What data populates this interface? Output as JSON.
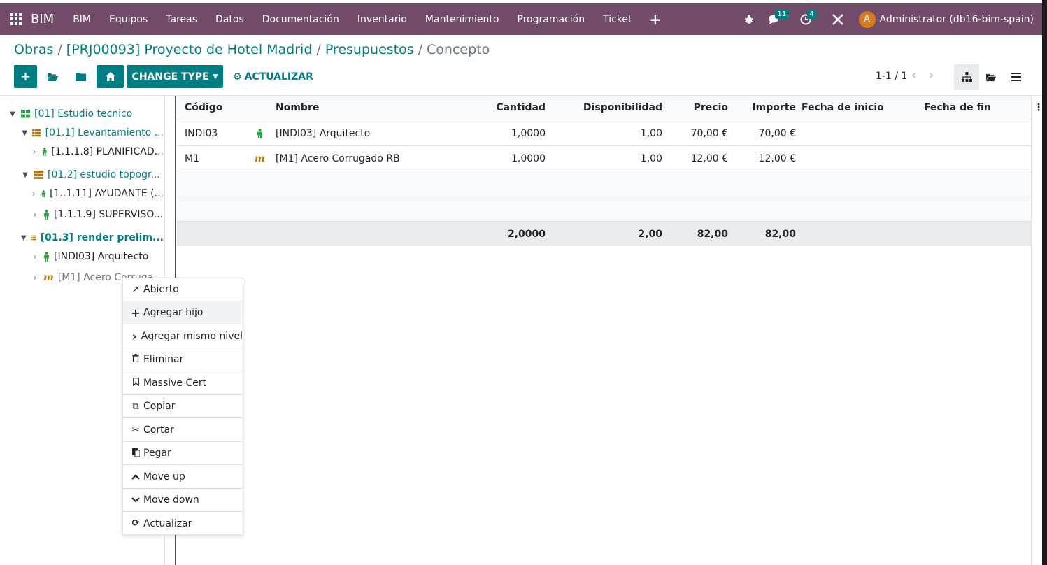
{
  "topbar": {
    "brand": "BIM",
    "menu": [
      "BIM",
      "Equipos",
      "Tareas",
      "Datos",
      "Documentación",
      "Inventario",
      "Mantenimiento",
      "Programación",
      "Ticket"
    ],
    "messages_count": "11",
    "activities_count": "4",
    "avatar_letter": "A",
    "user": "Administrator (db16-bim-spain)"
  },
  "breadcrumb": {
    "items": [
      "Obras",
      "[PRJ00093] Proyecto de Hotel Madrid",
      "Presupuestos"
    ],
    "current": "Concepto",
    "separator": "/"
  },
  "toolbar": {
    "change_type": "CHANGE TYPE",
    "update": "ACTUALIZAR",
    "pager": "1-1 / 1"
  },
  "tree": [
    {
      "label": "[01] Estudio tecnico",
      "icon": "grid-icon"
    },
    {
      "label": "[01.1] Levantamiento ...",
      "icon": "list-icon"
    },
    {
      "label": "[1.1.1.8] PLANIFICAD...",
      "icon": "person-icon"
    },
    {
      "label": "[01.2] estudio topogr...",
      "icon": "list-icon"
    },
    {
      "label": "[1..1.11] AYUDANTE (...",
      "icon": "person-icon"
    },
    {
      "label": "[1.1.1.9] SUPERVISO...",
      "icon": "person-icon"
    },
    {
      "label": "[01.3] render prelim...",
      "icon": "list-icon"
    },
    {
      "label": "[INDI03] Arquitecto",
      "icon": "person-icon"
    },
    {
      "label": "[M1] Acero Corruga...",
      "icon": "material-icon"
    }
  ],
  "table": {
    "columns": [
      "Código",
      "Nombre",
      "Cantidad",
      "Disponibilidad",
      "Precio",
      "Importe",
      "Fecha de inicio",
      "Fecha de fin"
    ],
    "rows": [
      {
        "codigo": "INDI03",
        "icon": "person-icon",
        "nombre": "[INDI03] Arquitecto",
        "cantidad": "1,0000",
        "disponibilidad": "1,00",
        "precio": "70,00 €",
        "importe": "70,00 €",
        "inicio": "",
        "fin": ""
      },
      {
        "codigo": "M1",
        "icon": "material-icon",
        "nombre": "[M1] Acero Corrugado RB",
        "cantidad": "1,0000",
        "disponibilidad": "1,00",
        "precio": "12,00 €",
        "importe": "12,00 €",
        "inicio": "",
        "fin": ""
      }
    ],
    "totals": {
      "cantidad": "2,0000",
      "disponibilidad": "2,00",
      "precio": "82,00",
      "importe": "82,00"
    }
  },
  "context_menu": [
    {
      "label": "Abierto",
      "icon": "external-link-icon",
      "glyph": "↗"
    },
    {
      "label": "Agregar hijo",
      "icon": "plus-icon",
      "glyph": "+"
    },
    {
      "label": "Agregar mismo nivel",
      "icon": "chevron-right-icon",
      "glyph": "›"
    },
    {
      "label": "Eliminar",
      "icon": "trash-icon",
      "glyph": "🗑"
    },
    {
      "label": "Massive Cert",
      "icon": "bookmark-icon",
      "glyph": "⌑"
    },
    {
      "label": "Copiar",
      "icon": "copy-icon",
      "glyph": "⧉"
    },
    {
      "label": "Cortar",
      "icon": "scissors-icon",
      "glyph": "✂"
    },
    {
      "label": "Pegar",
      "icon": "paste-icon",
      "glyph": "▤"
    },
    {
      "label": "Move up",
      "icon": "chevron-up-icon",
      "glyph": "⌃"
    },
    {
      "label": "Move down",
      "icon": "chevron-down-icon",
      "glyph": "⌄"
    },
    {
      "label": "Actualizar",
      "icon": "refresh-icon",
      "glyph": "⟳"
    }
  ]
}
